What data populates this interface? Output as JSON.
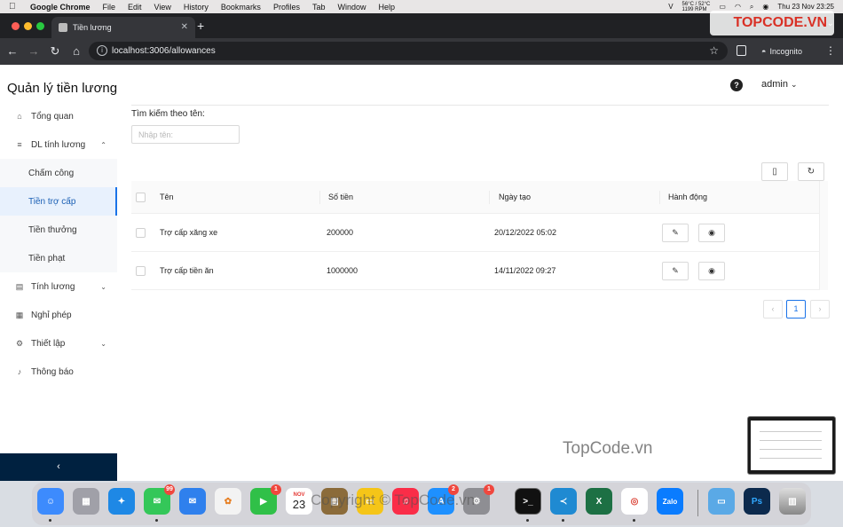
{
  "menubar": {
    "app": "Google Chrome",
    "items": [
      "File",
      "Edit",
      "View",
      "History",
      "Bookmarks",
      "Profiles",
      "Tab",
      "Window",
      "Help"
    ],
    "temp_line1": "56°C / 52°C",
    "temp_line2": "1199 RPM",
    "datetime": "Thu 23 Nov  23:25"
  },
  "browser": {
    "tab_title": "Tiền lương",
    "url": "localhost:3006/allowances",
    "incognito": "Incognito"
  },
  "app": {
    "logo": "Quản lý tiền lương",
    "menu": {
      "overview": "Tổng quan",
      "salary_data": "DL tính lương",
      "timekeeping": "Chấm công",
      "allowance": "Tiền trợ cấp",
      "bonus": "Tiền thưởng",
      "penalty": "Tiền phạt",
      "payroll": "Tính lương",
      "leave": "Nghỉ phép",
      "settings": "Thiết lập",
      "notifications": "Thông báo"
    },
    "collapse_icon": "‹",
    "help": "?",
    "user": "admin",
    "search_label": "Tìm kiếm theo tên:",
    "search_placeholder": "Nhập tên:",
    "search_value": "",
    "table": {
      "headers": [
        "Tên",
        "Số tiền",
        "Ngày tạo",
        "Hành động"
      ],
      "rows": [
        {
          "name": "Trợ cấp xăng xe",
          "amount": "200000",
          "created": "20/12/2022 05:02"
        },
        {
          "name": "Trợ cấp tiền ăn",
          "amount": "1000000",
          "created": "14/11/2022 09:27"
        }
      ]
    },
    "pagination": {
      "prev": "‹",
      "current": "1",
      "next": "›"
    }
  },
  "watermarks": {
    "top_right": "TOPCODE.VN",
    "middle": "TopCode.vn",
    "bottom": "Copyright © TopCode.vn"
  },
  "dock": {
    "messages_badge": "99",
    "facetime_badge": "1",
    "calendar_month": "NOV",
    "calendar_day": "23",
    "appstore_badge": "2",
    "settings_badge": "1"
  }
}
